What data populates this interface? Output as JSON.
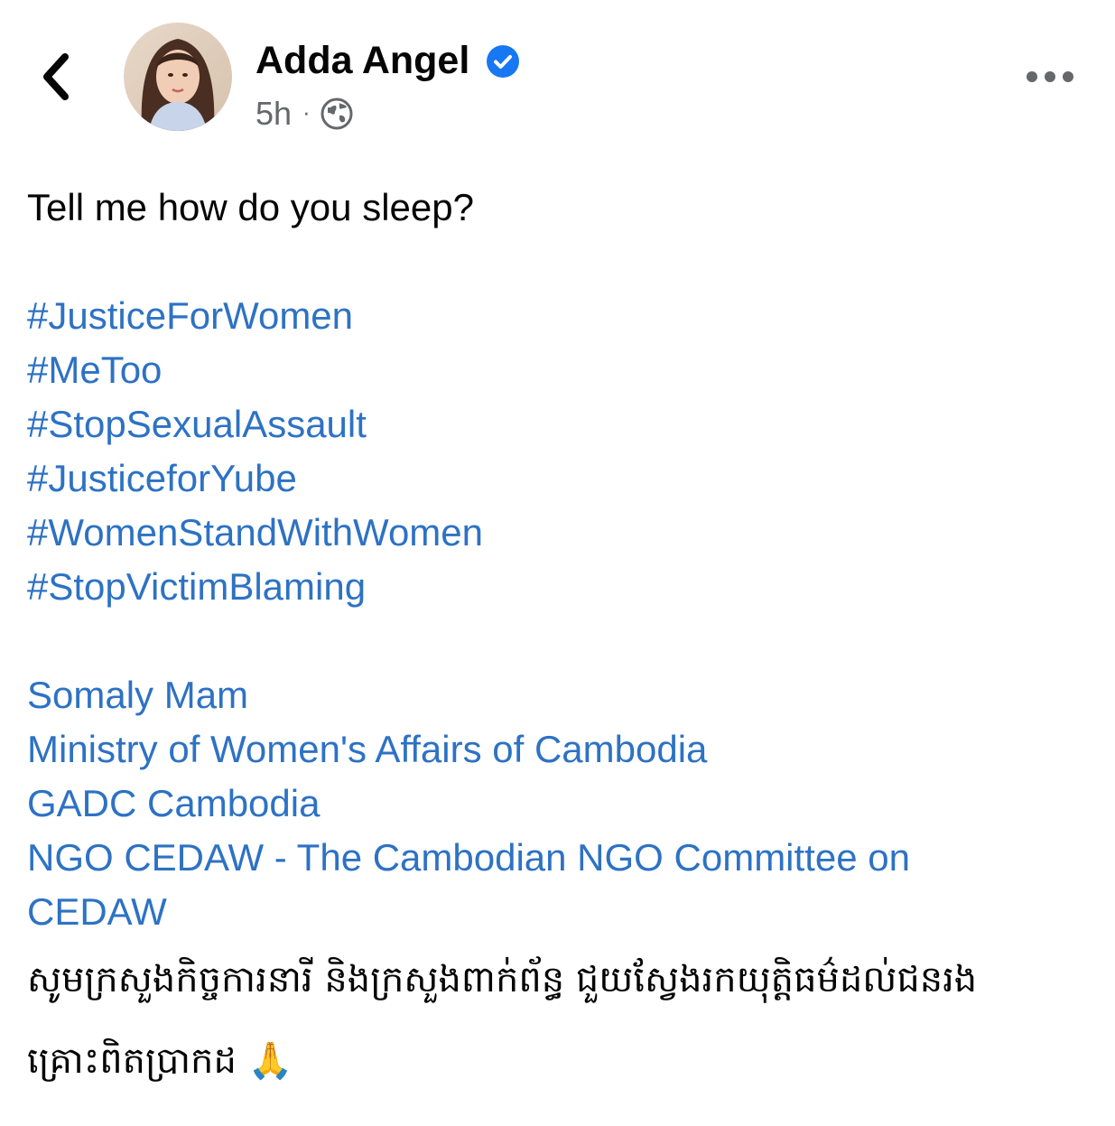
{
  "header": {
    "author_name": "Adda Angel",
    "timestamp": "5h",
    "separator": "·",
    "privacy_icon": "globe-icon",
    "back_icon": "chevron-left-icon",
    "more_icon": "more-horizontal-icon",
    "verified_icon": "verified-badge-icon"
  },
  "post": {
    "text": "Tell me how do you sleep?",
    "hashtags": [
      "#JusticeForWomen",
      "#MeToo",
      "#StopSexualAssault",
      "#JusticeforYube",
      "#WomenStandWithWomen",
      "#StopVictimBlaming"
    ],
    "tags": [
      "Somaly Mam",
      "Ministry of Women's Affairs of Cambodia",
      "GADC Cambodia",
      "NGO CEDAW - The Cambodian NGO Committee on",
      "CEDAW"
    ],
    "khmer_text": "សូមក្រសួងកិច្ចការនារី និងក្រសួងពាក់ព័ន្ធ ជួយស្វែងរកយុត្តិធម៌ដល់ជនរងគ្រោះពិតប្រាកដ 🙏"
  },
  "colors": {
    "link": "#2d72c4",
    "text": "#050505",
    "meta": "#65676b",
    "verified": "#1877f2"
  }
}
